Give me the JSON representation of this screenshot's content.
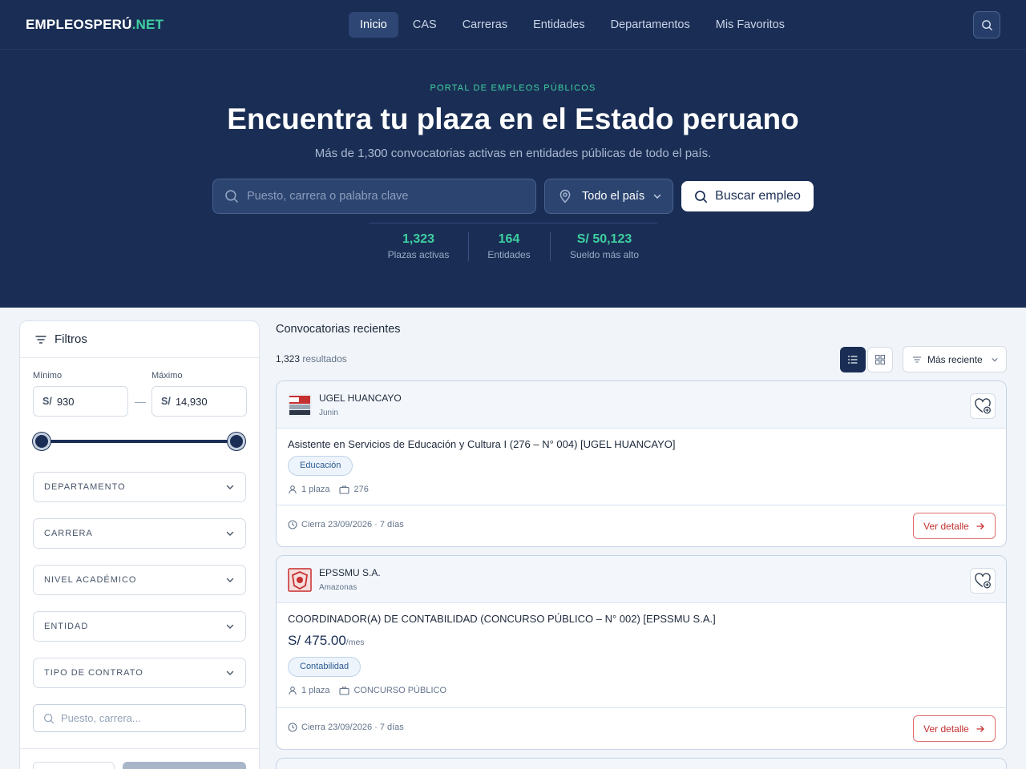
{
  "nav": {
    "brand_main": "EMPLEOSPERÚ",
    "brand_accent": ".NET",
    "links": [
      "Inicio",
      "CAS",
      "Carreras",
      "Entidades",
      "Departamentos",
      "Mis Favoritos"
    ],
    "active_index": 0
  },
  "hero": {
    "eyebrow": "PORTAL DE EMPLEOS PÚBLICOS",
    "title": "Encuentra tu plaza en el Estado peruano",
    "subtitle": "Más de 1,300 convocatorias activas en entidades públicas de todo el país.",
    "search_placeholder": "Puesto, carrera o palabra clave",
    "location": "Todo el país",
    "search_button": "Buscar empleo",
    "stats": [
      {
        "value": "1,323",
        "label": "Plazas activas"
      },
      {
        "value": "164",
        "label": "Entidades"
      },
      {
        "value": "S/ 50,123",
        "label": "Sueldo más alto"
      }
    ]
  },
  "filters": {
    "title": "Filtros",
    "min_label": "Mínimo",
    "max_label": "Máximo",
    "currency": "S/",
    "min_value": "930",
    "max_value": "14,930",
    "dropdowns": [
      "DEPARTAMENTO",
      "CARRERA",
      "NIVEL ACADÉMICO",
      "ENTIDAD",
      "TIPO DE CONTRATO"
    ],
    "search_placeholder": "Puesto, carrera..."
  },
  "main": {
    "section_title": "Convocatorias recientes",
    "results_count": "1,323",
    "results_label": "resultados",
    "sort_label": "Más reciente"
  },
  "jobs": [
    {
      "entity": "UGEL HUANCAYO",
      "region": "Junin",
      "title": "Asistente en Servicios de Educación y Cultura I (276 – N° 004) [UGEL HUANCAYO]",
      "salary": "",
      "salary_unit": "",
      "tag": "Educación",
      "vacancies": "1 plaza",
      "contract": "276",
      "closing": "Cierra 23/09/2026 · 7 días",
      "detail_button": "Ver detalle"
    },
    {
      "entity": "EPSSMU S.A.",
      "region": "Amazonas",
      "title": "COORDINADOR(A) DE CONTABILIDAD (CONCURSO PÚBLICO – N° 002) [EPSSMU S.A.]",
      "salary": "S/ 475.00",
      "salary_unit": "/mes",
      "tag": "Contabilidad",
      "vacancies": "1 plaza",
      "contract": "CONCURSO PÚBLICO",
      "closing": "Cierra 23/09/2026 · 7 días",
      "detail_button": "Ver detalle"
    }
  ],
  "colors": {
    "navy": "#1a2e55",
    "accent": "#3ecfa0",
    "danger": "#c53030"
  }
}
